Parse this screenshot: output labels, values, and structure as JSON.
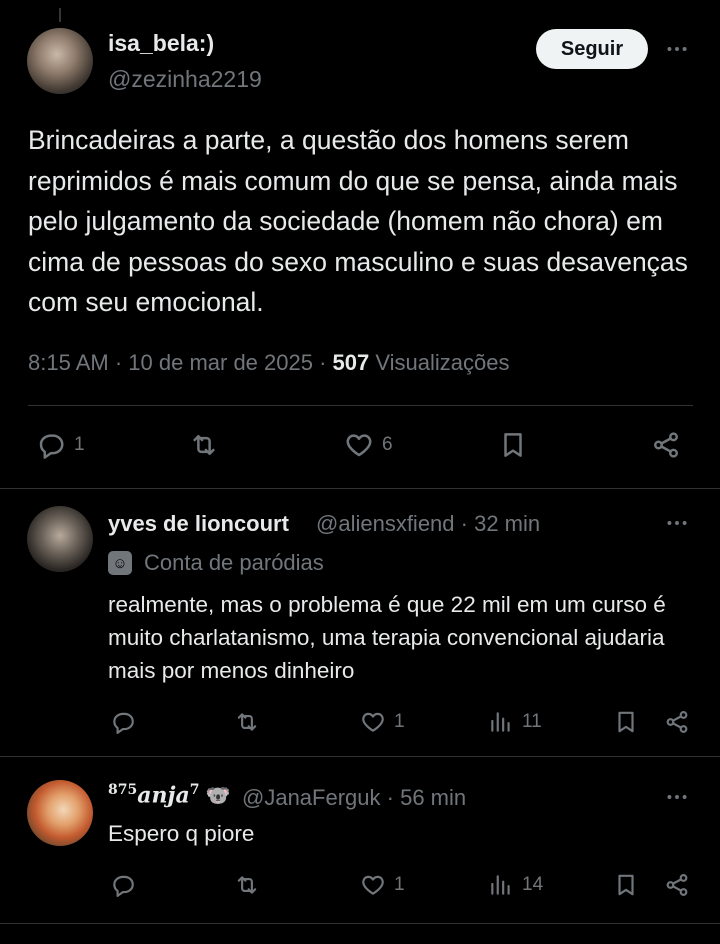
{
  "main_post": {
    "display_name": "isa_bela:)",
    "handle": "@zezinha2219",
    "follow_label": "Seguir",
    "text": "Brincadeiras a parte, a questão dos homens serem reprimidos é mais comum do que se pensa, ainda mais pelo julgamento da sociedade (homem não chora) em cima de pessoas do sexo masculino e suas desavenças com seu emocional.",
    "time": "8:15 AM",
    "date": "10 de mar de 2025",
    "views": "507",
    "views_label": "Visualizações",
    "reply_count": "1",
    "like_count": "6"
  },
  "replies": [
    {
      "display_name": "yves de lioncourt",
      "handle": "@aliensxfiend",
      "age": "32 min",
      "parody_label": "Conta de paródias",
      "text": "realmente, mas o problema é que 22 mil em um curso é muito charlatanismo, uma terapia convencional ajudaria mais por menos dinheiro",
      "like_count": "1",
      "view_count": "11"
    },
    {
      "display_name_sup_left": "875",
      "display_name_main": "anja",
      "display_name_sup_right": "7",
      "handle": "@JanaFerguk",
      "age": "56 min",
      "text": "Espero q piore",
      "like_count": "1",
      "view_count": "14"
    }
  ],
  "separator": " · ",
  "icons": {
    "reply": "reply-icon",
    "retweet": "retweet-icon",
    "like": "heart-icon",
    "bookmark": "bookmark-icon",
    "share": "share-icon",
    "views": "views-icon",
    "more": "more-icon",
    "parody": "parody-mask-icon",
    "koala": "koala-emoji"
  },
  "colors": {
    "background": "#000000",
    "text": "#e7e9ea",
    "muted": "#71767b",
    "divider": "#2f3336"
  }
}
